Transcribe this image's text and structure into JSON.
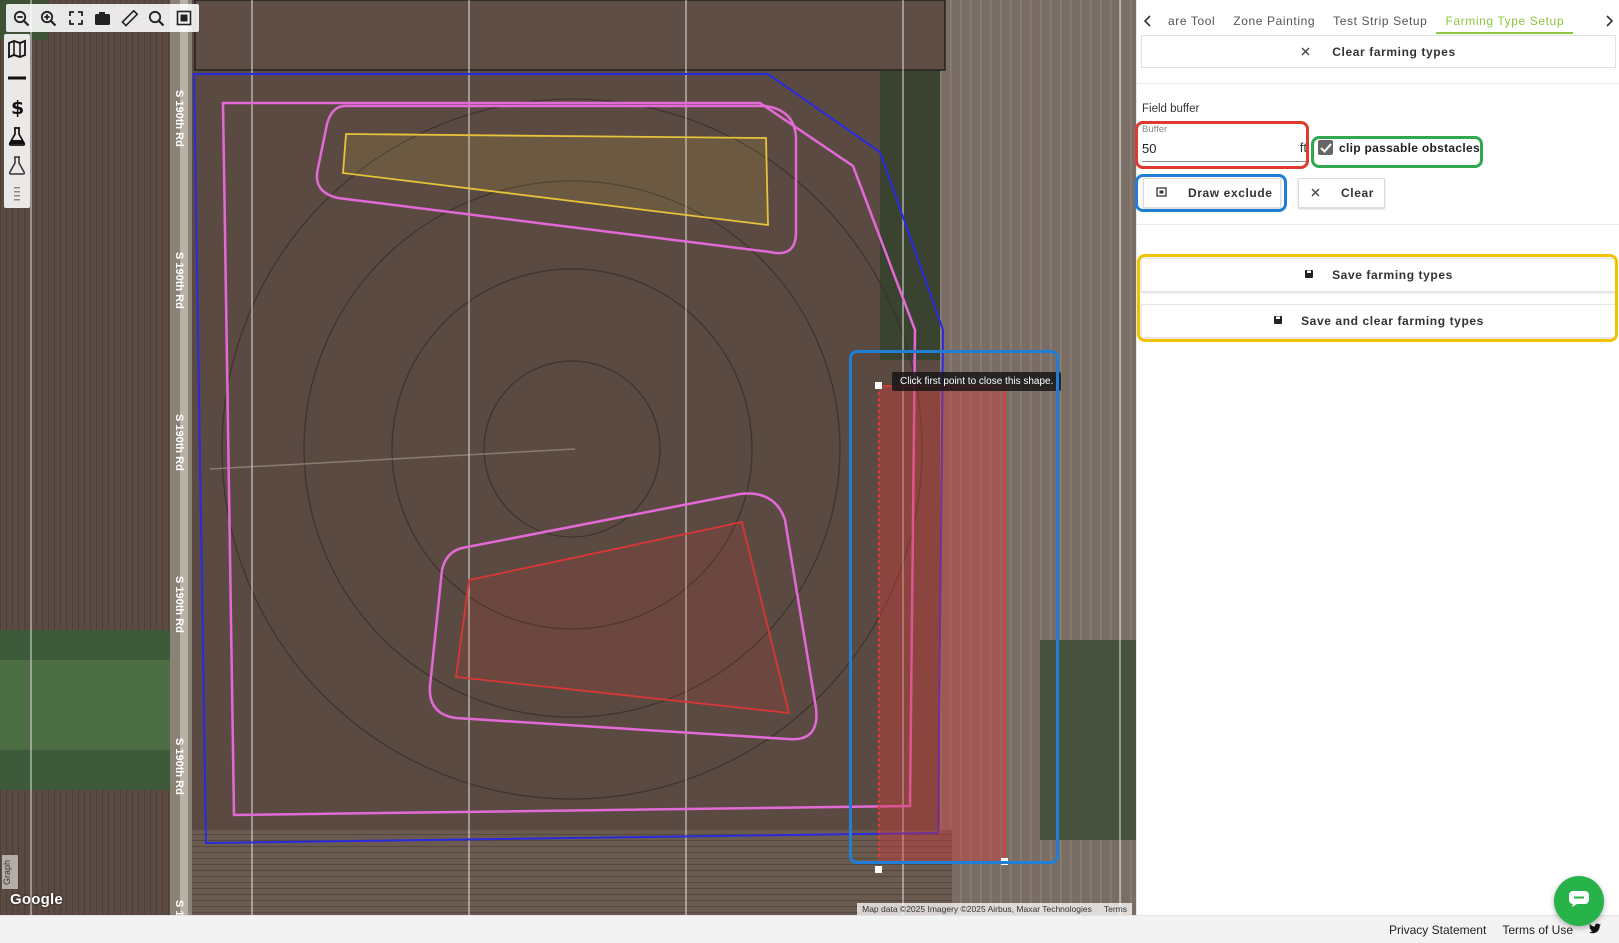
{
  "tabs": {
    "items": [
      "are Tool",
      "Zone Painting",
      "Test Strip Setup",
      "Farming Type Setup"
    ],
    "active_index": 3
  },
  "panel": {
    "clear_farming_types": "Clear farming types",
    "field_buffer_label": "Field buffer",
    "buffer": {
      "label": "Buffer",
      "value": "50",
      "unit": "ft"
    },
    "clip_passable_obstacles": {
      "label": "clip passable obstacles",
      "checked": true
    },
    "draw_exclude": "Draw exclude",
    "clear": "Clear",
    "save_farming_types": "Save farming types",
    "save_and_clear_farming_types": "Save and clear farming types"
  },
  "map": {
    "road_label": "S 190th Rd",
    "tooltip": "Click first point to close this shape.",
    "google_logo": "Google",
    "attribution": "Map data ©2025 Imagery ©2025 Airbus, Maxar Technologies",
    "terms_link": "Terms",
    "graph_tab": "Graph",
    "toolbar_icons": [
      "zoom-out-icon",
      "zoom-in-icon",
      "fit-extent-icon",
      "camera-icon",
      "ruler-icon",
      "search-icon",
      "layers-icon"
    ],
    "side_icons": [
      "map-icon",
      "line-icon",
      "dollar-icon",
      "flask-icon",
      "flask-outline-icon",
      "drag-handle-icon"
    ]
  },
  "footer": {
    "privacy": "Privacy Statement",
    "terms": "Terms of Use"
  },
  "colors": {
    "accent_green": "#8dc63f",
    "field_boundary": "#2a2ae0",
    "buffer_outline": "#e36ad6",
    "zone_yellow": "#e8c23a",
    "zone_red": "#d93636",
    "highlight_red": "#e03a2f",
    "highlight_green": "#2fa84f",
    "highlight_blue": "#1f7fd6",
    "highlight_yellow": "#f2c200",
    "chat_green": "#27b24a"
  }
}
